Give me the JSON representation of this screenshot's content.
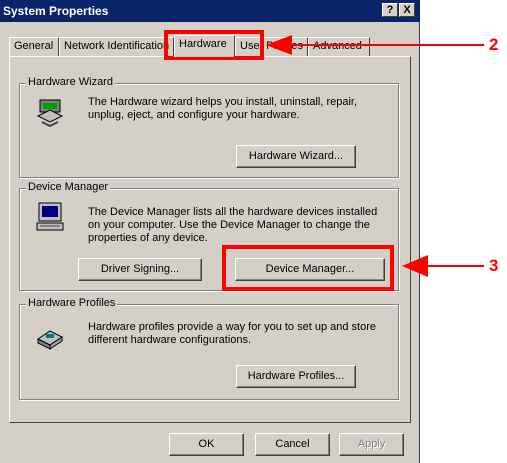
{
  "window": {
    "title": "System Properties",
    "help_button": "?",
    "close_button": "X"
  },
  "tabs": [
    {
      "label": "General"
    },
    {
      "label": "Network Identification"
    },
    {
      "label": "Hardware"
    },
    {
      "label": "User Profiles"
    },
    {
      "label": "Advanced"
    }
  ],
  "hardware_wizard": {
    "legend": "Hardware Wizard",
    "description": "The Hardware wizard helps you install, uninstall, repair, unplug, eject, and configure your hardware.",
    "button": "Hardware Wizard...",
    "icon": "hardware-wizard-icon"
  },
  "device_manager": {
    "legend": "Device Manager",
    "description": "The Device Manager lists all the hardware devices installed on your computer. Use the Device Manager to change the properties of any device.",
    "driver_signing_button": "Driver Signing...",
    "device_manager_button": "Device Manager...",
    "icon": "computer-icon"
  },
  "hardware_profiles": {
    "legend": "Hardware Profiles",
    "description": "Hardware profiles provide a way for you to set up and store different hardware configurations.",
    "button": "Hardware Profiles...",
    "icon": "hardware-profiles-icon"
  },
  "footer": {
    "ok": "OK",
    "cancel": "Cancel",
    "apply": "Apply"
  },
  "annotations": {
    "step2": "2",
    "step3": "3",
    "color": "#ff0000"
  }
}
